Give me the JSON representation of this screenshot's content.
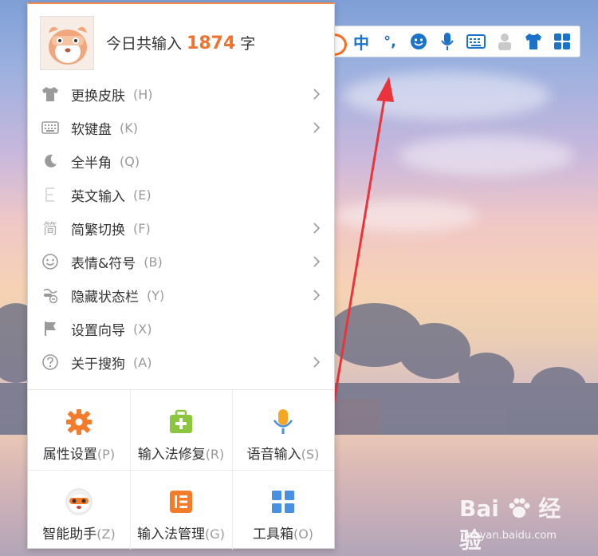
{
  "header": {
    "prefix": "今日共输入",
    "count": "1874",
    "suffix": "字"
  },
  "menu_items": [
    {
      "label": "更换皮肤",
      "key": "(H)",
      "icon": "shirt-icon",
      "has_submenu": true
    },
    {
      "label": "软键盘",
      "key": "(K)",
      "icon": "keyboard-icon",
      "has_submenu": true
    },
    {
      "label": "全半角",
      "key": "(Q)",
      "icon": "moon-icon",
      "has_submenu": false
    },
    {
      "label": "英文输入",
      "key": "(E)",
      "icon": "letter-e-icon",
      "has_submenu": false
    },
    {
      "label": "简繁切换",
      "key": "(F)",
      "icon": "jian-char-icon",
      "glyph": "简",
      "has_submenu": true
    },
    {
      "label": "表情&符号",
      "key": "(B)",
      "icon": "smiley-icon",
      "has_submenu": true
    },
    {
      "label": "隐藏状态栏",
      "key": "(Y)",
      "icon": "hide-statusbar-icon",
      "has_submenu": true
    },
    {
      "label": "设置向导",
      "key": "(X)",
      "icon": "flag-icon",
      "has_submenu": false
    },
    {
      "label": "关于搜狗",
      "key": "(A)",
      "icon": "help-circle-icon",
      "has_submenu": true
    }
  ],
  "grid_items": [
    {
      "label": "属性设置",
      "key": "(P)",
      "icon": "gear-icon",
      "color": "#f47b2a"
    },
    {
      "label": "输入法修复",
      "key": "(R)",
      "icon": "repair-kit-icon",
      "color": "#8cc63f"
    },
    {
      "label": "语音输入",
      "key": "(S)",
      "icon": "microphone-icon",
      "color": "#f5a623"
    },
    {
      "label": "智能助手",
      "key": "(Z)",
      "icon": "assistant-mascot-icon",
      "color": "#f47b2a"
    },
    {
      "label": "输入法管理",
      "key": "(G)",
      "icon": "manage-list-icon",
      "color": "#f47b2a"
    },
    {
      "label": "工具箱",
      "key": "(O)",
      "icon": "toolbox-grid-icon",
      "color": "#4a90e2"
    }
  ],
  "toolbar": {
    "zh_label": "中",
    "punct_label": "°,",
    "icons": [
      "sogou-logo-icon",
      "chinese-mode-icon",
      "punctuation-icon",
      "emoji-icon",
      "microphone-icon",
      "keyboard-icon",
      "user-icon",
      "skin-shirt-icon",
      "toolbox-icon"
    ],
    "accent": "#1a73c9"
  },
  "watermark": {
    "brand": "Bai",
    "brand_suffix": "经验",
    "url": "jingyan.baidu.com"
  },
  "colors": {
    "accent_orange": "#f2712f",
    "menu_text": "#333333",
    "shortcut_text": "#9a9a9a",
    "arrow_red": "#e8343a"
  }
}
